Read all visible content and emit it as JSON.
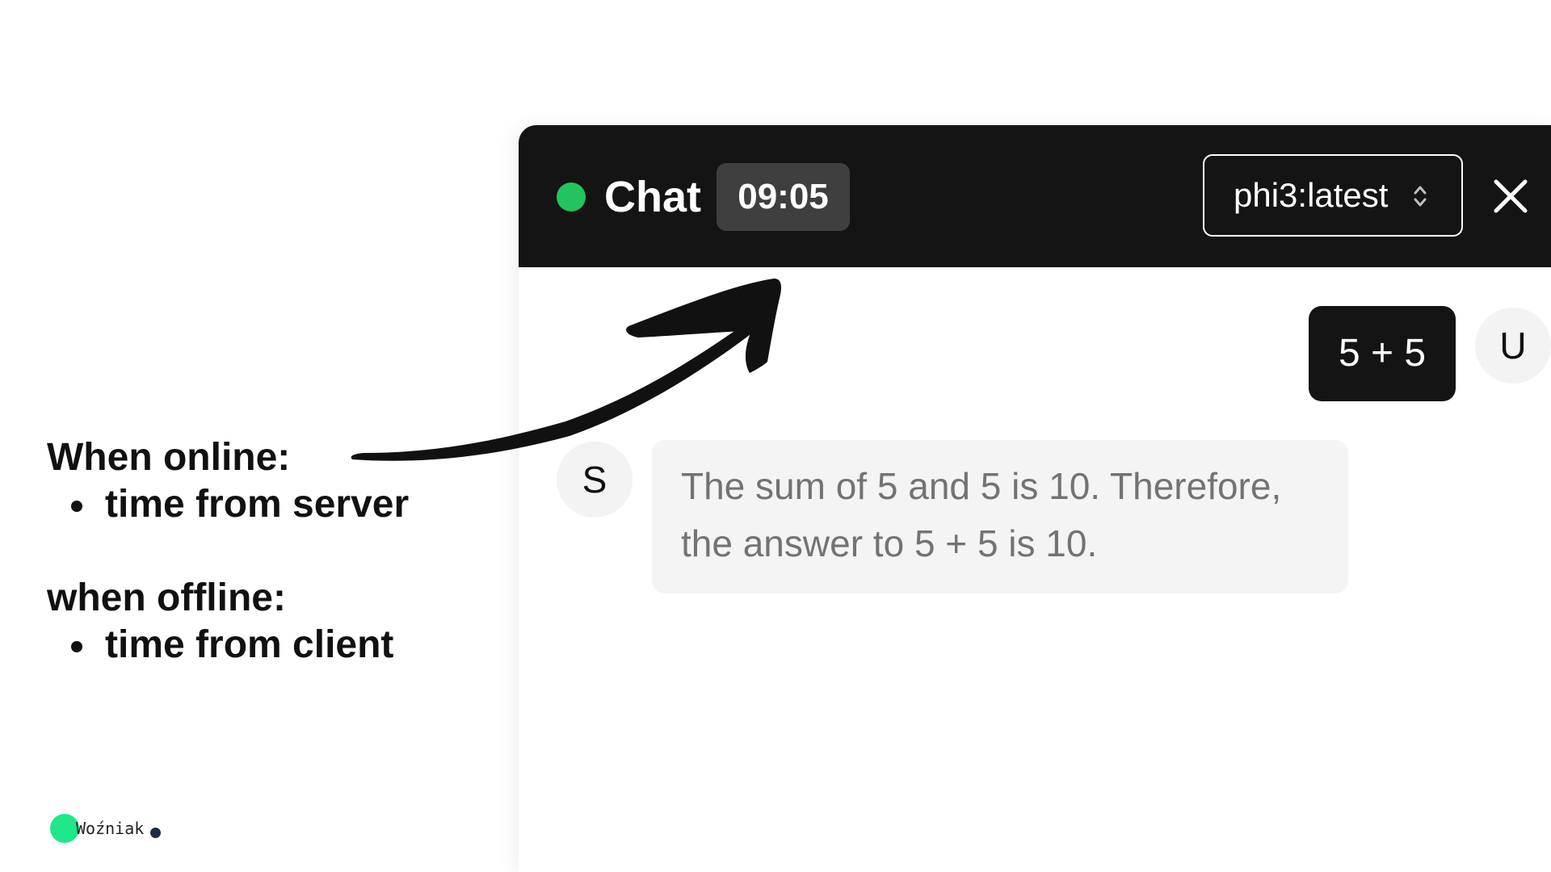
{
  "notes": {
    "online_heading": "When online:",
    "online_item": "time from server",
    "offline_heading": "when offline:",
    "offline_item": "time from client"
  },
  "chat": {
    "title": "Chat",
    "time": "09:05",
    "model": "phi3:latest",
    "status_color": "#21c45d",
    "messages": [
      {
        "role": "user",
        "avatar": "U",
        "text": "5 + 5"
      },
      {
        "role": "system",
        "avatar": "S",
        "text": "The sum of 5 and 5 is 10. Therefore, the answer to 5 + 5 is 10."
      }
    ]
  },
  "icons": {
    "status": "status-dot-icon",
    "select": "chevron-up-down-icon",
    "close": "close-icon"
  },
  "logo": {
    "text": "Woźniak",
    "accent": "#1ee88a"
  }
}
